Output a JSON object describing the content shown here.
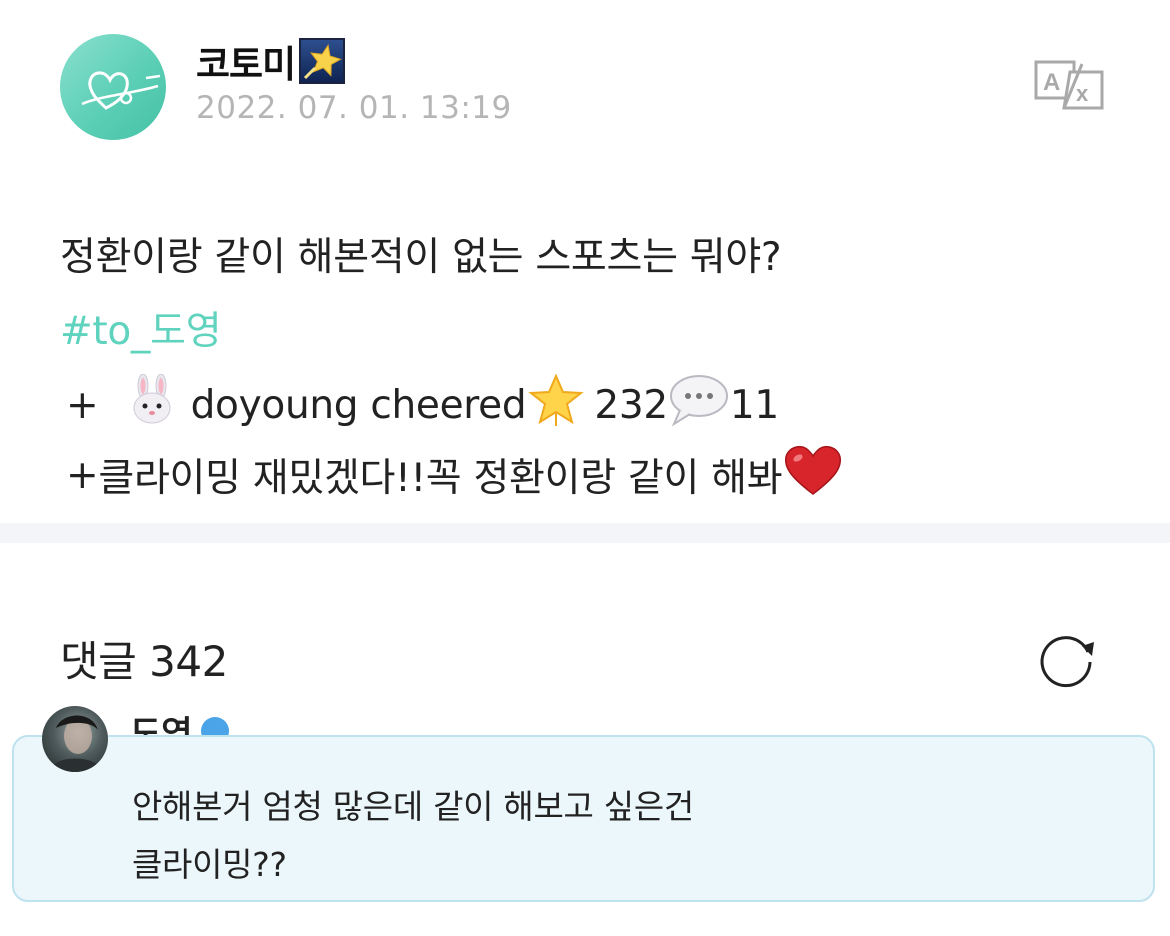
{
  "post": {
    "author": "코토미",
    "author_badge_icon": "star-badge-icon",
    "timestamp": "2022. 07. 01. 13:19",
    "translate_icon": "translate-icon",
    "line1": "정환이랑 같이 해본적이 없는 스포츠는 뭐야?",
    "hashtag": "#to_도영",
    "line3_prefix": "+ ",
    "line3_text": " doyoung cheered",
    "cheer_count": "232",
    "comment_count_inline": "11",
    "line4_prefix": "+",
    "line4_text": "클라이밍 재밌겠다!!꼭 정환이랑 같이 해봐"
  },
  "comments": {
    "header": "댓글 342",
    "refresh_icon": "refresh-icon",
    "items": [
      {
        "author": "도영",
        "line1": "안해본거 엄청 많은데 같이 해보고 싶은건",
        "line2": "클라이밍??"
      }
    ]
  },
  "colors": {
    "hashtag": "#5fd3be",
    "timestamp": "#b5b5b5",
    "comment_bg": "#ecf7fc",
    "comment_border": "#bfe2ef",
    "divider": "#f4f5f8"
  }
}
